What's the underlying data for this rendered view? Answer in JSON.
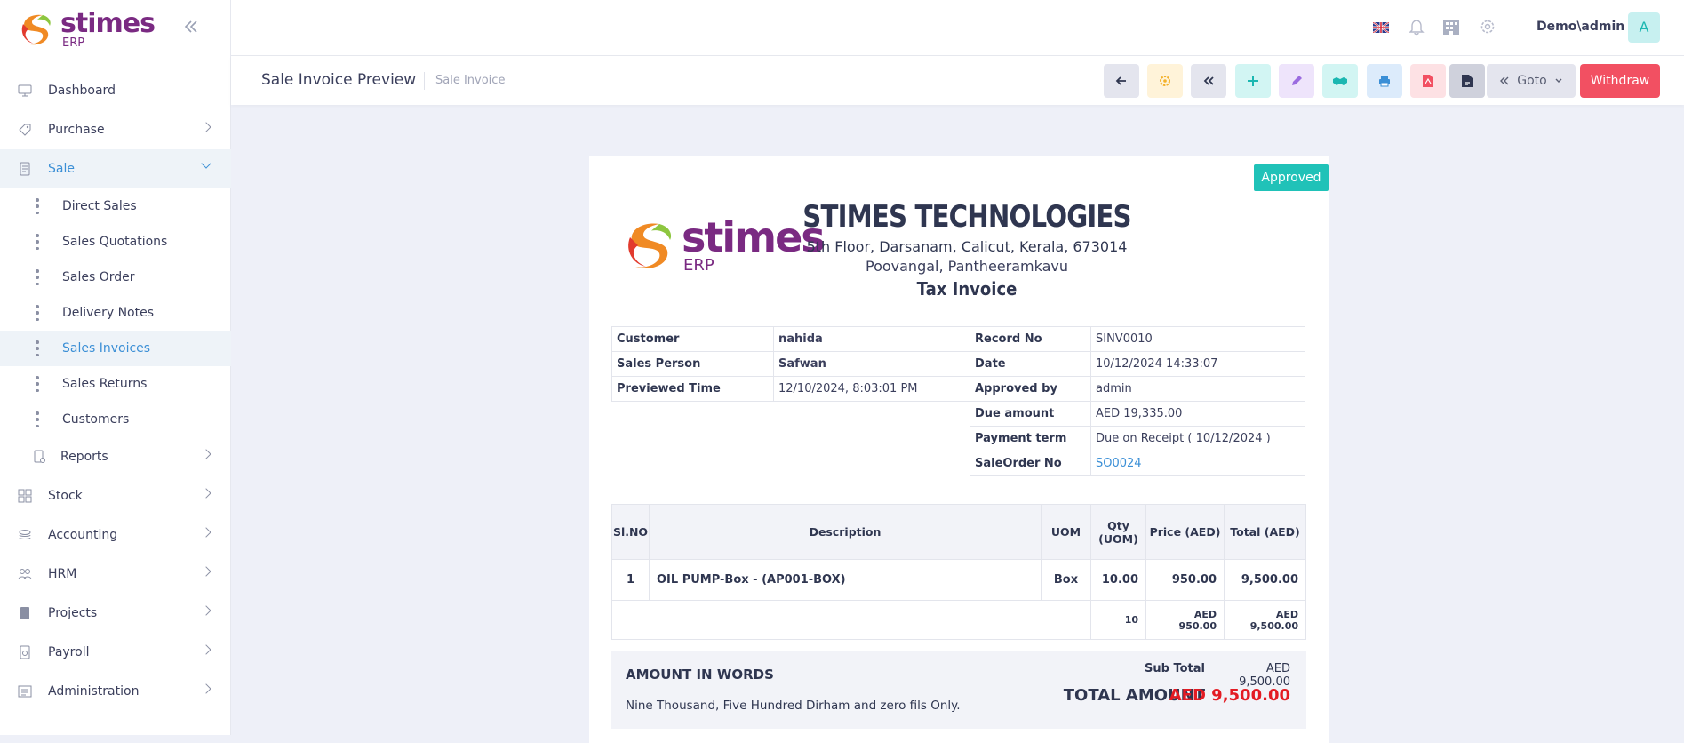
{
  "app": {
    "logo_main": "stimes",
    "logo_sub": "ERP",
    "collapse_icon": "double-chevron-left-icon"
  },
  "sidebar": {
    "items": [
      {
        "label": "Dashboard",
        "icon": "monitor-icon"
      },
      {
        "label": "Purchase",
        "icon": "tag-icon"
      },
      {
        "label": "Sale",
        "icon": "receipt-icon"
      },
      {
        "label": "Stock",
        "icon": "grid-icon"
      },
      {
        "label": "Accounting",
        "icon": "layers-icon"
      },
      {
        "label": "HRM",
        "icon": "users-icon"
      },
      {
        "label": "Projects",
        "icon": "book-icon"
      },
      {
        "label": "Payroll",
        "icon": "payslip-icon"
      },
      {
        "label": "Administration",
        "icon": "admin-icon"
      }
    ],
    "sale_children": [
      {
        "label": "Direct Sales"
      },
      {
        "label": "Sales Quotations"
      },
      {
        "label": "Sales Order"
      },
      {
        "label": "Delivery Notes"
      },
      {
        "label": "Sales Invoices"
      },
      {
        "label": "Sales Returns"
      },
      {
        "label": "Customers"
      },
      {
        "label": "Reports"
      }
    ]
  },
  "topbar": {
    "user": "Demo\\admin",
    "avatar": "A"
  },
  "toolbar": {
    "title": "Sale Invoice Preview",
    "breadcrumb": "Sale Invoice",
    "goto_label": "Goto",
    "withdraw_label": "Withdraw",
    "buttons": [
      "back-arrow-icon",
      "settings-icon",
      "first-page-icon",
      "add-icon",
      "edit-icon",
      "handshake-icon",
      "print-icon",
      "pdf-icon",
      "document-icon"
    ]
  },
  "invoice": {
    "status": "Approved",
    "logo_main": "stimes",
    "logo_sub": "ERP",
    "company_name": "STIMES TECHNOLOGIES",
    "address_line1": "5th Floor, Darsanam, Calicut, Kerala, 673014",
    "address_line2": "Poovangal, Pantheeramkavu",
    "doc_type": "Tax Invoice",
    "left": [
      {
        "k": "Customer",
        "v": "nahida"
      },
      {
        "k": "Sales Person",
        "v": "Safwan"
      },
      {
        "k": "Previewed Time",
        "v": "12/10/2024, 8:03:01 PM"
      }
    ],
    "right": [
      {
        "k": "Record No",
        "v": "SINV0010"
      },
      {
        "k": "Date",
        "v": "10/12/2024 14:33:07"
      },
      {
        "k": "Approved by",
        "v": "admin"
      },
      {
        "k": "Due amount",
        "v": "AED 19,335.00"
      },
      {
        "k": "Payment term",
        "v": "Due on Receipt ( 10/12/2024 )"
      },
      {
        "k": "SaleOrder No",
        "v": "SO0024"
      }
    ],
    "columns": {
      "slno": "Sl.NO",
      "desc": "Description",
      "uom": "UOM",
      "qty": "Qty (UOM)",
      "price": "Price (AED)",
      "total": "Total (AED)"
    },
    "lines": [
      {
        "slno": "1",
        "desc": "OIL PUMP-Box - (AP001-BOX)",
        "uom": "Box",
        "qty": "10.00",
        "price": "950.00",
        "total": "9,500.00"
      }
    ],
    "summary": {
      "qty": "10",
      "price": "AED 950.00",
      "total": "AED 9,500.00"
    },
    "amount_in_words_label": "AMOUNT IN WORDS",
    "amount_in_words": "Nine Thousand, Five Hundred Dirham and zero fils Only.",
    "subtotal_label": "Sub Total",
    "subtotal": "AED 9,500.00",
    "total_label": "TOTAL AMOUNT",
    "total": "AED 9,500.00"
  }
}
